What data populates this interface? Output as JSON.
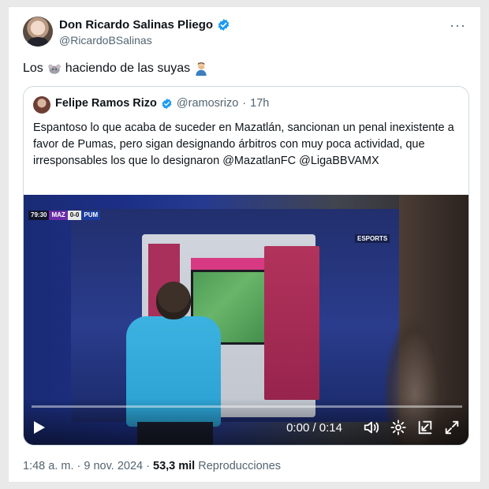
{
  "author": {
    "display_name": "Don Ricardo Salinas Pliego",
    "handle": "@RicardoBSalinas"
  },
  "tweet": {
    "text_before": "Los",
    "emoji_rat": "rat-emoji",
    "text_middle": "haciendo de las suyas",
    "emoji_person": "person-emoji"
  },
  "quoted": {
    "display_name": "Felipe Ramos Rizo",
    "handle": "@ramosrizo",
    "separator": "·",
    "time": "17h",
    "text": "Espantoso lo que acaba de suceder en Mazatlán, sancionan un penal inexistente a favor de Pumas, pero sigan designando árbitros con muy poca actividad, que irresponsables los que lo designaron @MazatlanFC @LigaBBVAMX",
    "video": {
      "scorebug": {
        "clock": "79:30",
        "team1": "MAZ",
        "score": "0-0",
        "team2": "PUM"
      },
      "broadcaster": "ESPORTS",
      "time_display": "0:00 / 0:14",
      "progress": 0.0
    }
  },
  "footer": {
    "time": "1:48 a. m.",
    "sep1": "·",
    "date": "9 nov. 2024",
    "sep2": "·",
    "views_count": "53,3 mil",
    "views_label": "Reproducciones"
  },
  "colors": {
    "verified": "#1d9bf0",
    "text_secondary": "#536471",
    "border": "#cfd9de"
  }
}
